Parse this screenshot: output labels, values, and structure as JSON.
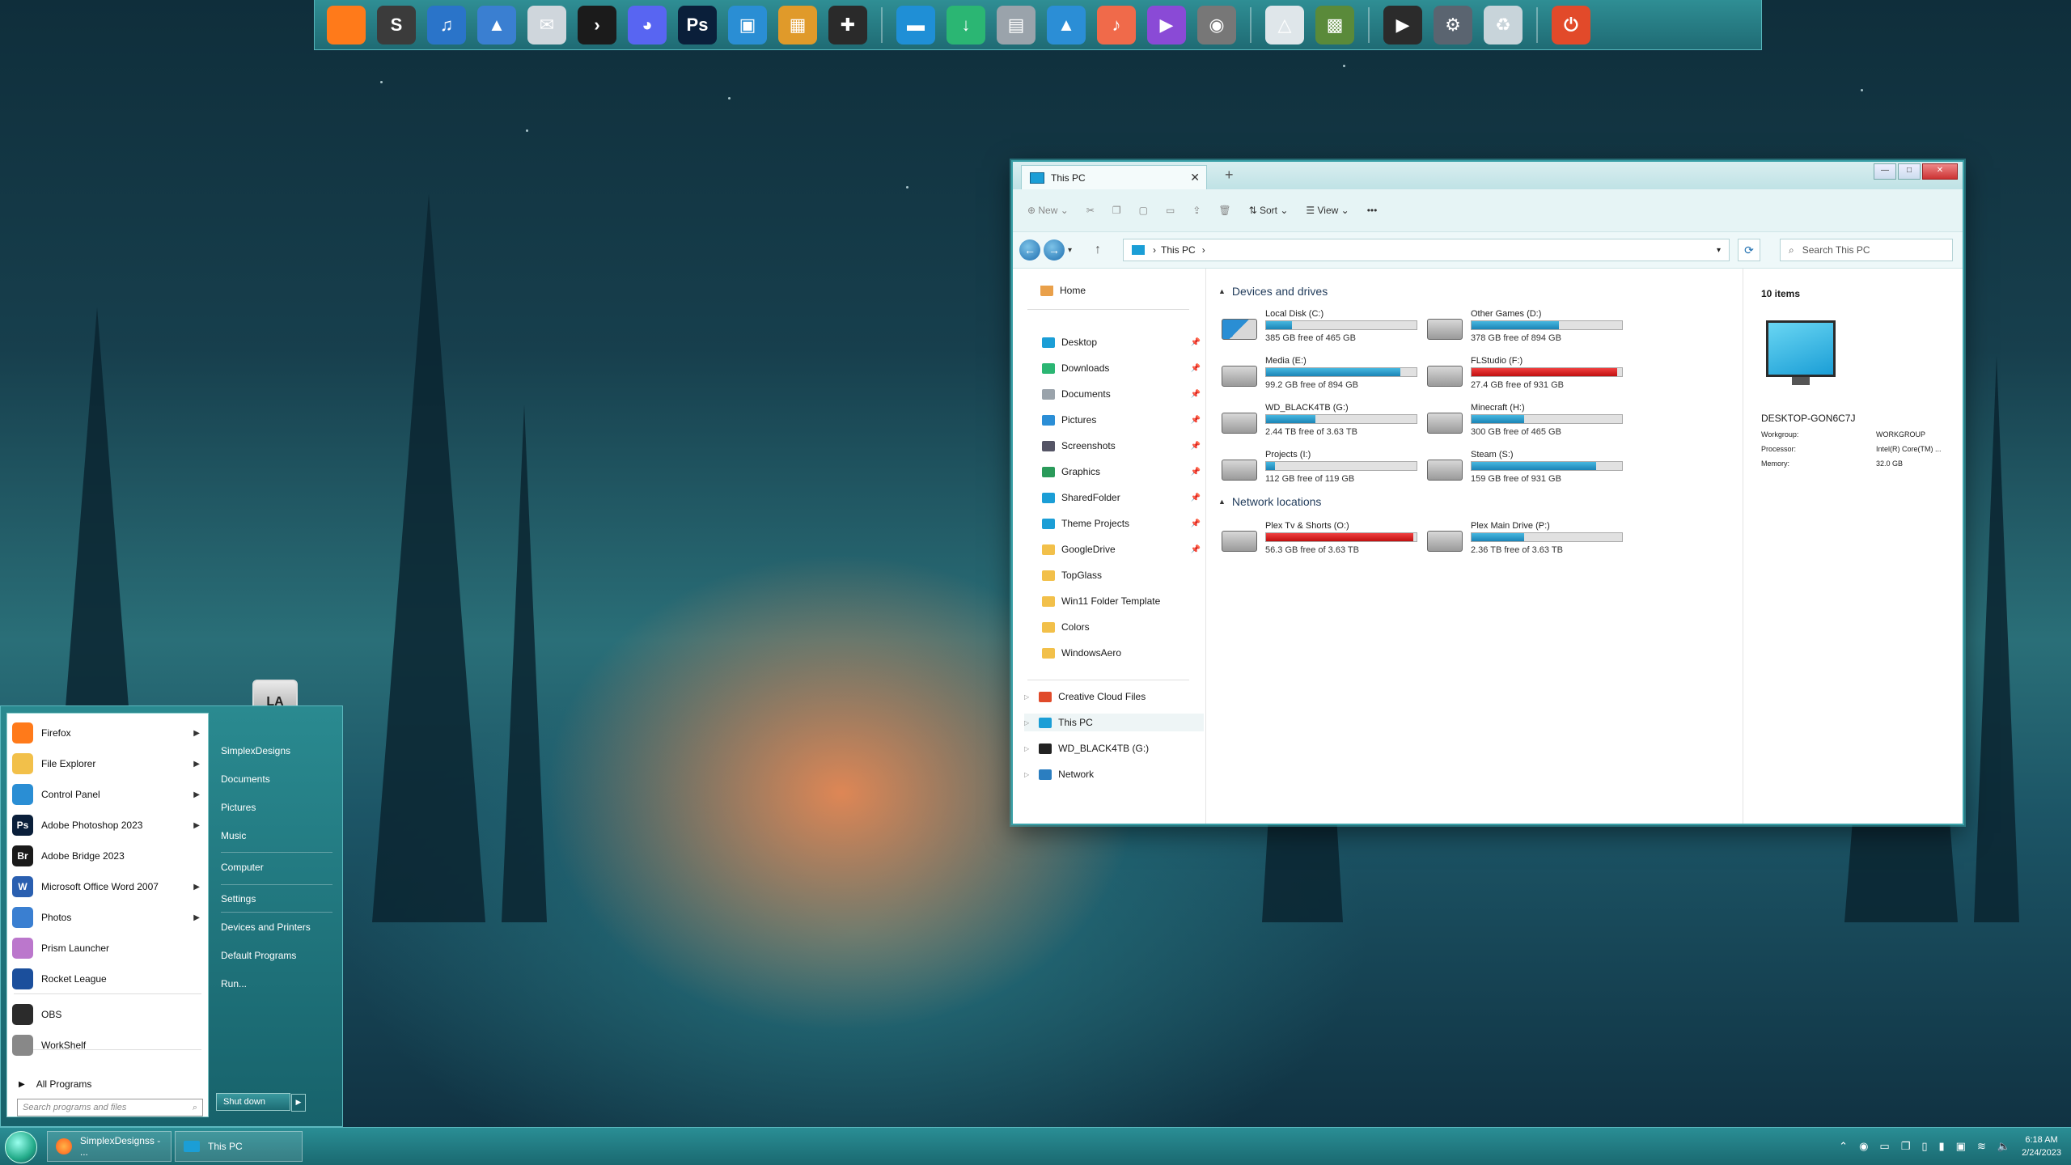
{
  "dock": {
    "icons": [
      {
        "name": "firefox-icon",
        "glyph": "",
        "color": "#ff7a1a"
      },
      {
        "name": "sublime-text-icon",
        "glyph": "S",
        "color": "#3b3b3b"
      },
      {
        "name": "headphones-icon",
        "glyph": "♫",
        "color": "#2a74c9"
      },
      {
        "name": "photos-icon",
        "glyph": "▲",
        "color": "#3a7fd1"
      },
      {
        "name": "mail-icon",
        "glyph": "✉",
        "color": "#cfd6dc"
      },
      {
        "name": "plex-icon",
        "glyph": "›",
        "color": "#1b1b1b"
      },
      {
        "name": "discord-icon",
        "glyph": "◕",
        "color": "#5865f2"
      },
      {
        "name": "photoshop-icon",
        "glyph": "Ps",
        "color": "#0a1f3a"
      },
      {
        "name": "display-icon",
        "glyph": "▣",
        "color": "#2a8ed4"
      },
      {
        "name": "control-panel-icon",
        "glyph": "▦",
        "color": "#e09a2a"
      },
      {
        "name": "gamepad-icon",
        "glyph": "✚",
        "color": "#2a2a2a"
      },
      {
        "name": "folder-desktop-icon",
        "glyph": "▬",
        "color": "#1f8fd6"
      },
      {
        "name": "folder-downloads-icon",
        "glyph": "↓",
        "color": "#2bb673"
      },
      {
        "name": "folder-documents-icon",
        "glyph": "▤",
        "color": "#9aa3ab"
      },
      {
        "name": "folder-pictures-icon",
        "glyph": "▲",
        "color": "#2b8ed6"
      },
      {
        "name": "folder-music-icon",
        "glyph": "♪",
        "color": "#f06a4a"
      },
      {
        "name": "folder-videos-icon",
        "glyph": "▶",
        "color": "#8a4ad6"
      },
      {
        "name": "camera-icon",
        "glyph": "◉",
        "color": "#777"
      },
      {
        "name": "google-drive-icon",
        "glyph": "△",
        "color": "#dfe6ea"
      },
      {
        "name": "minecraft-icon",
        "glyph": "▩",
        "color": "#5a8a3a"
      },
      {
        "name": "media-player-icon",
        "glyph": "▶",
        "color": "#2b2b2b"
      },
      {
        "name": "settings-gear-icon",
        "glyph": "⚙",
        "color": "#5a6470"
      },
      {
        "name": "recycle-bin-icon",
        "glyph": "♻",
        "color": "#c8d4da"
      },
      {
        "name": "power-icon",
        "glyph": "⏻",
        "color": "#e24a2a"
      }
    ]
  },
  "explorer": {
    "tab_title": "This PC",
    "new_tab": "+",
    "controls": {
      "min": "—",
      "max": "□",
      "close": "✕"
    },
    "commands": {
      "new": "New",
      "sort": "Sort",
      "view": "View",
      "more": "•••"
    },
    "address": "This PC",
    "search_placeholder": "Search This PC",
    "nav": {
      "home": "Home",
      "quick": [
        "Desktop",
        "Downloads",
        "Documents",
        "Pictures",
        "Screenshots",
        "Graphics",
        "SharedFolder",
        "Theme Projects",
        "GoogleDrive",
        "TopGlass",
        "Win11 Folder Template",
        "Colors",
        "WindowsAero"
      ],
      "tree": [
        "Creative Cloud Files",
        "This PC",
        "WD_BLACK4TB (G:)",
        "Network"
      ]
    },
    "groups": {
      "devices": "Devices and drives",
      "network": "Network locations"
    },
    "drives": [
      {
        "name": "Local Disk (C:)",
        "free": "385 GB free of 465 GB",
        "used": 0.17,
        "red": false
      },
      {
        "name": "Other Games (D:)",
        "free": "378 GB free of 894 GB",
        "used": 0.58,
        "red": false
      },
      {
        "name": "Media (E:)",
        "free": "99.2 GB free of 894 GB",
        "used": 0.89,
        "red": false
      },
      {
        "name": "FLStudio (F:)",
        "free": "27.4 GB free of 931 GB",
        "used": 0.97,
        "red": true
      },
      {
        "name": "WD_BLACK4TB (G:)",
        "free": "2.44 TB free of 3.63 TB",
        "used": 0.33,
        "red": false
      },
      {
        "name": "Minecraft (H:)",
        "free": "300 GB free of 465 GB",
        "used": 0.35,
        "red": false
      },
      {
        "name": "Projects (I:)",
        "free": "112 GB free of 119 GB",
        "used": 0.06,
        "red": false
      },
      {
        "name": "Steam (S:)",
        "free": "159 GB free of 931 GB",
        "used": 0.83,
        "red": false
      }
    ],
    "network_drives": [
      {
        "name": "Plex Tv & Shorts (O:)",
        "free": "56.3 GB free of 3.63 TB",
        "used": 0.98,
        "red": true
      },
      {
        "name": "Plex Main Drive (P:)",
        "free": "2.36 TB free of 3.63 TB",
        "used": 0.35,
        "red": false
      }
    ],
    "details": {
      "count": "10 items",
      "pc_name": "DESKTOP-GON6C7J",
      "rows": [
        {
          "k": "Workgroup:",
          "v": "WORKGROUP"
        },
        {
          "k": "Processor:",
          "v": "Intel(R) Core(TM) ..."
        },
        {
          "k": "Memory:",
          "v": "32.0 GB"
        }
      ]
    }
  },
  "start_menu": {
    "avatar_text": "LA",
    "programs": [
      {
        "label": "Firefox",
        "sub": true,
        "icon": "firefox-icon",
        "color": "#ff7a1a",
        "glyph": ""
      },
      {
        "label": "File Explorer",
        "sub": true,
        "icon": "folder-icon",
        "color": "#f2c04a",
        "glyph": ""
      },
      {
        "label": "Control Panel",
        "sub": true,
        "icon": "control-panel-icon",
        "color": "#2a8ed4",
        "glyph": ""
      },
      {
        "label": "Adobe Photoshop 2023",
        "sub": true,
        "icon": "photoshop-icon",
        "color": "#0a1f3a",
        "glyph": "Ps"
      },
      {
        "label": "Adobe Bridge 2023",
        "sub": false,
        "icon": "bridge-icon",
        "color": "#1a1a1a",
        "glyph": "Br"
      },
      {
        "label": "Microsoft Office Word 2007",
        "sub": true,
        "icon": "word-icon",
        "color": "#2a5fb0",
        "glyph": "W"
      },
      {
        "label": "Photos",
        "sub": true,
        "icon": "photos-icon",
        "color": "#3a7fd1",
        "glyph": ""
      },
      {
        "label": "Prism Launcher",
        "sub": false,
        "icon": "prism-launcher-icon",
        "color": "#b7c",
        "glyph": ""
      },
      {
        "label": "Rocket League",
        "sub": false,
        "icon": "rocket-league-icon",
        "color": "#1b4f9c",
        "glyph": ""
      },
      {
        "label": "OBS",
        "sub": false,
        "icon": "obs-icon",
        "color": "#2b2b2b",
        "glyph": ""
      },
      {
        "label": "WorkShelf",
        "sub": false,
        "icon": "workshelf-icon",
        "color": "#888",
        "glyph": ""
      }
    ],
    "all_programs": "All Programs",
    "search_placeholder": "Search programs and files",
    "right": [
      "SimplexDesigns",
      "Documents",
      "Pictures",
      "Music",
      "Computer",
      "Settings",
      "Devices and Printers",
      "Default Programs",
      "Run..."
    ],
    "shutdown": "Shut down"
  },
  "taskbar": {
    "buttons": [
      "SimplexDesignss - ...",
      "This PC"
    ],
    "time": "6:18 AM",
    "date": "2/24/2023"
  }
}
